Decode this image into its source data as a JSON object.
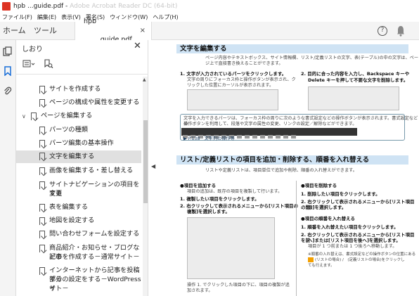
{
  "window": {
    "title_main": "hpb ...guide.pdf -",
    "title_dim": " Adobe Acrobat Reader DC (64-bit)"
  },
  "menu": [
    "ファイル(F)",
    "編集(E)",
    "表示(V)",
    "署名(S)",
    "ウィンドウ(W)",
    "ヘルプ(H)"
  ],
  "tabs": {
    "home": "ホーム",
    "tools": "ツール",
    "doc": "hpb _____guide.pdf"
  },
  "panel": {
    "title": "しおり",
    "bookmarks": [
      {
        "label": "サイトを作成する",
        "level": 1
      },
      {
        "label": "ページの構成や属性を変更する",
        "level": 1
      },
      {
        "label": "ページを編集する",
        "level": 0,
        "expanded": true
      },
      {
        "label": "パーツの種類",
        "level": 1
      },
      {
        "label": "パーツ編集の基本操作",
        "level": 1
      },
      {
        "label": "文字を編集する",
        "level": 1,
        "selected": true
      },
      {
        "label": "画像を編集する・差し替える",
        "level": 1
      },
      {
        "label": "サイトナビゲーションの項目を変更する",
        "level": 1,
        "line1": "サイトナビゲーションの項目を変更",
        "line2": "する"
      },
      {
        "label": "表を編集する",
        "level": 1
      },
      {
        "label": "地図を設定する",
        "level": 1
      },
      {
        "label": "問い合わせフォームを設定する",
        "level": 1
      },
      {
        "label": "商品紹介・お知らせ・ブログなどの記事を作成する－通常サイト－",
        "level": 1,
        "line1": "商品紹介・お知らせ・ブログなどの",
        "line2": "記事を作成する－通常サイト－"
      },
      {
        "label": "インターネットから記事を投稿する部分の設定をする－WordPressサイト－",
        "level": 1,
        "line1": "インターネットから記事を投稿する",
        "line2": "部分の設定をする－WordPressサ",
        "line3": "イト－"
      }
    ]
  },
  "doc": {
    "h1": "文字を編集する",
    "p1a": "ページ内容やテキストボックス、サイト情報欄、リスト/定義リストの文字、表(テーブル)の中の文字は、ペー",
    "p1b": "ジ上で直接書き換えることができます。",
    "s1": "1. 文字が入力されているパーツをクリックします。",
    "s1d": "文字の周りにフォーカス枠と操作ボタンが表示され、ク",
    "s1e": "リックした位置にカーソルが表示されます。",
    "s2": "2. 目的に合った内容を入力し、Backspace キーや",
    "s2b": "Delete キーを押して不要な文字を削除します。",
    "c1": "文字を入力できるパーツは、フォーカス枠の周りに次のような書式設定などの操作ボタンが表示されます。書式設定などの",
    "c2": "操作ボタンを利用して、段落や文字の属性の変更、リンクの設定／解除などができます。",
    "ref": "▶ P.138　文字列の操作等",
    "h2": "リスト/定義リストの項目を追加・削除する、順番を入れ替える",
    "p2": "リストや定義リストは、項目単位で追加や削除、順番の入れ替えができます。",
    "l1": "●項目を追加する",
    "l1d": "項目の追加は、既存の項目を複製して行います。",
    "l2": "1. 複製したい項目をクリックします。",
    "l3": "2. 右クリックして表示されるメニューから[リスト項目の",
    "l3b": "複製]を選択します。",
    "lcap1": "操作 1. でクリックした項目の下に、項目の複製が追",
    "lcap2": "加されます。",
    "r1": "●項目を削除する",
    "r2": "1. 削除したい項目をクリックします。",
    "r3": "2. 右クリックして表示されるメニューから[リスト項目の削",
    "r3b": "除]を選択します。",
    "r4": "●項目の順番を入れ替える",
    "r5": "1. 順番を入れ替えたい項目をクリックします。",
    "r6": "2. 右クリックして表示されるメニューから[リスト項目を前",
    "r6b": "へ]または[リスト項目を後へ]を選択します。",
    "r6c": "項目が 1 つ前または 1 つ後ろへ移動します。",
    "r7": "※順番の入れ替えは、書式設定などの操作ボタンの位置にある",
    "r7b": "(リストの場合) /　(定義リストの場合)をクリックし",
    "r7c": "ても行えます。"
  }
}
